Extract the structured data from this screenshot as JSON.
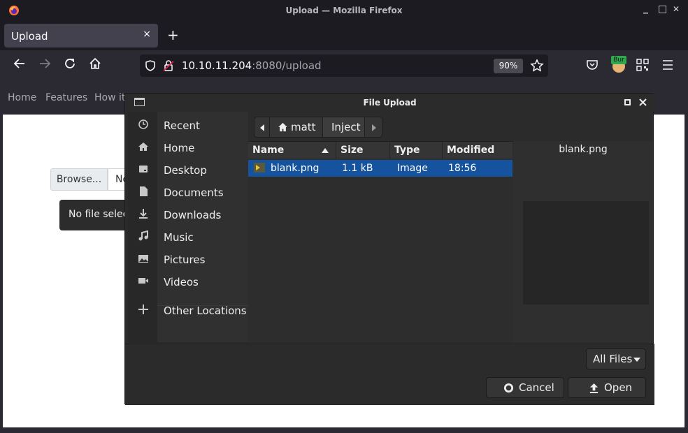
{
  "window": {
    "title": "Upload — Mozilla Firefox",
    "controls": {
      "minimize": "_",
      "maximize": "□",
      "close": "✕"
    }
  },
  "tab": {
    "label": "Upload",
    "close": "×",
    "new_tab": "+"
  },
  "navbar": {
    "url_host": "10.10.11.204",
    "url_rest": ":8080/upload",
    "zoom": "90%",
    "burp_badge": "Bur"
  },
  "page": {
    "nav": [
      "Home",
      "Features",
      "How it"
    ],
    "browse_label": "Browse...",
    "file_field_text": "No",
    "tooltip": "No file selected."
  },
  "dialog": {
    "title": "File Upload",
    "places": [
      {
        "label": "Recent",
        "icon": "clock-icon"
      },
      {
        "label": "Home",
        "icon": "home-icon"
      },
      {
        "label": "Desktop",
        "icon": "desktop-icon"
      },
      {
        "label": "Documents",
        "icon": "document-icon"
      },
      {
        "label": "Downloads",
        "icon": "download-icon"
      },
      {
        "label": "Music",
        "icon": "music-icon"
      },
      {
        "label": "Pictures",
        "icon": "picture-icon"
      },
      {
        "label": "Videos",
        "icon": "video-icon"
      }
    ],
    "other_locations": "Other Locations",
    "path": {
      "home": "matt",
      "current": "Inject"
    },
    "columns": {
      "name": "Name",
      "size": "Size",
      "type": "Type",
      "modified": "Modified"
    },
    "files": [
      {
        "name": "blank.png",
        "size": "1.1 kB",
        "type": "Image",
        "modified": "18:56"
      }
    ],
    "preview_name": "blank.png",
    "filter": "All Files",
    "cancel": "Cancel",
    "open": "Open"
  },
  "colors": {
    "selection": "#15539e",
    "dialog_bg": "#2b2b2b",
    "toolbar_bg": "#2b2a33",
    "titlebar_bg": "#1c1b22"
  }
}
